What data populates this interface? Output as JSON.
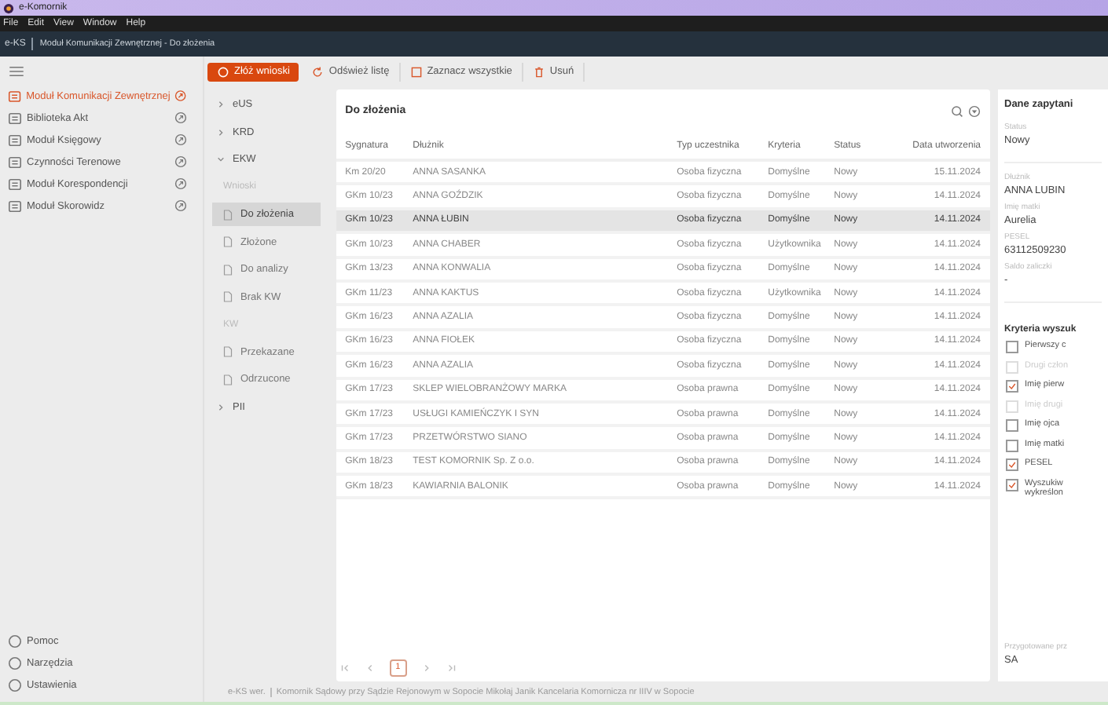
{
  "window": {
    "title": "e-Komornik"
  },
  "menu": [
    "File",
    "Edit",
    "View",
    "Window",
    "Help"
  ],
  "header": {
    "app": "e-KS",
    "breadcrumb": "Moduł Komunikacji Zewnętrznej - Do złożenia"
  },
  "sidebar": {
    "items": [
      {
        "label": "Moduł Komunikacji Zewnętrznej",
        "selected": true
      },
      {
        "label": "Biblioteka Akt",
        "selected": false
      },
      {
        "label": "Moduł Księgowy",
        "selected": false
      },
      {
        "label": "Czynności Terenowe",
        "selected": false
      },
      {
        "label": "Moduł Korespondencji",
        "selected": false
      },
      {
        "label": "Moduł Skorowidz",
        "selected": false
      }
    ],
    "footer": [
      "Pomoc",
      "Narzędzia",
      "Ustawienia"
    ]
  },
  "toolbar": [
    {
      "label": "Złóż wnioski",
      "kind": "primary"
    },
    {
      "label": "Odśwież listę",
      "kind": "refresh"
    },
    {
      "label": "Zaznacz wszystkie",
      "kind": "select"
    },
    {
      "label": "Usuń",
      "kind": "delete"
    }
  ],
  "tree": [
    {
      "label": "eUS",
      "expanded": false
    },
    {
      "label": "KRD",
      "expanded": false
    },
    {
      "label": "EKW",
      "expanded": true,
      "children": [
        {
          "kind": "heading",
          "label": "Wnioski"
        },
        {
          "kind": "item",
          "label": "Do złożenia",
          "selected": true
        },
        {
          "kind": "item",
          "label": "Złożone",
          "selected": false
        },
        {
          "kind": "item",
          "label": "Do analizy",
          "selected": false
        },
        {
          "kind": "item",
          "label": "Brak KW",
          "selected": false
        },
        {
          "kind": "heading",
          "label": "KW"
        },
        {
          "kind": "item",
          "label": "Przekazane",
          "selected": false
        },
        {
          "kind": "item",
          "label": "Odrzucone",
          "selected": false
        }
      ]
    },
    {
      "label": "PII",
      "expanded": false
    }
  ],
  "table": {
    "title": "Do złożenia",
    "columns": [
      "Sygnatura",
      "Dłużnik",
      "Typ uczestnika",
      "Kryteria",
      "Status",
      "Data utworzenia"
    ],
    "rows": [
      {
        "cells": [
          "Km 20/20",
          "ANNA SASANKA",
          "Osoba fizyczna",
          "Domyślne",
          "Nowy",
          "15.11.2024"
        ],
        "selected": false
      },
      {
        "cells": [
          "GKm 10/23",
          "ANNA GOŹDZIK",
          "Osoba fizyczna",
          "Domyślne",
          "Nowy",
          "14.11.2024"
        ],
        "selected": false
      },
      {
        "cells": [
          "GKm 10/23",
          "ANNA ŁUBIN",
          "Osoba fizyczna",
          "Domyślne",
          "Nowy",
          "14.11.2024"
        ],
        "selected": true
      },
      {
        "cells": [
          "GKm 10/23",
          "ANNA CHABER",
          "Osoba fizyczna",
          "Użytkownika",
          "Nowy",
          "14.11.2024"
        ],
        "selected": false
      },
      {
        "cells": [
          "GKm 13/23",
          "ANNA KONWALIA",
          "Osoba fizyczna",
          "Domyślne",
          "Nowy",
          "14.11.2024"
        ],
        "selected": false
      },
      {
        "cells": [
          "GKm 11/23",
          "ANNA KAKTUS",
          "Osoba fizyczna",
          "Użytkownika",
          "Nowy",
          "14.11.2024"
        ],
        "selected": false
      },
      {
        "cells": [
          "GKm 16/23",
          "ANNA AZALIA",
          "Osoba fizyczna",
          "Domyślne",
          "Nowy",
          "14.11.2024"
        ],
        "selected": false
      },
      {
        "cells": [
          "GKm 16/23",
          "ANNA FIOŁEK",
          "Osoba fizyczna",
          "Domyślne",
          "Nowy",
          "14.11.2024"
        ],
        "selected": false
      },
      {
        "cells": [
          "GKm 16/23",
          "ANNA AZALIA",
          "Osoba fizyczna",
          "Domyślne",
          "Nowy",
          "14.11.2024"
        ],
        "selected": false
      },
      {
        "cells": [
          "GKm 17/23",
          "SKLEP WIELOBRANŻOWY MARKA",
          "Osoba prawna",
          "Domyślne",
          "Nowy",
          "14.11.2024"
        ],
        "selected": false
      },
      {
        "cells": [
          "GKm 17/23",
          "USŁUGI KAMIEŃCZYK I SYN",
          "Osoba prawna",
          "Domyślne",
          "Nowy",
          "14.11.2024"
        ],
        "selected": false
      },
      {
        "cells": [
          "GKm 17/23",
          "PRZETWÓRSTWO SIANO",
          "Osoba prawna",
          "Domyślne",
          "Nowy",
          "14.11.2024"
        ],
        "selected": false
      },
      {
        "cells": [
          "GKm 18/23",
          "TEST KOMORNIK Sp. Z o.o.",
          "Osoba prawna",
          "Domyślne",
          "Nowy",
          "14.11.2024"
        ],
        "selected": false
      },
      {
        "cells": [
          "GKm 18/23",
          "KAWIARNIA BALONIK",
          "Osoba prawna",
          "Domyślne",
          "Nowy",
          "14.11.2024"
        ],
        "selected": false
      }
    ],
    "page": "1"
  },
  "details": {
    "title": "Dane zapytani",
    "groups": [
      [
        {
          "label": "Status",
          "value": "Nowy"
        }
      ],
      [
        {
          "label": "Dłużnik",
          "value": "ANNA LUBIN"
        },
        {
          "label": "Imię matki",
          "value": "Aurelia"
        },
        {
          "label": "PESEL",
          "value": "63112509230"
        },
        {
          "label": "Saldo zaliczki",
          "value": "-"
        }
      ]
    ],
    "criteria_title": "Kryteria wyszuk",
    "criteria": [
      {
        "label": "Pierwszy c",
        "checked": false,
        "disabled": false
      },
      {
        "label": "Drugi człon",
        "checked": false,
        "disabled": true
      },
      {
        "label": "Imię pierw",
        "checked": true,
        "disabled": false
      },
      {
        "label": "Imię drugi",
        "checked": false,
        "disabled": true
      },
      {
        "label": "Imię ojca",
        "checked": false,
        "disabled": false
      },
      {
        "label": "Imię matki",
        "checked": false,
        "disabled": false
      },
      {
        "label": "PESEL",
        "checked": true,
        "disabled": false
      },
      {
        "label": "Wyszukiw wykreślon",
        "checked": true,
        "disabled": false
      }
    ],
    "prepared_label": "Przygotowane prz",
    "prepared_value": "SA"
  },
  "status_bar": {
    "version_label": "e-KS wer.",
    "text": "Komornik Sądowy przy Sądzie Rejonowym w Sopocie Mikołaj Janik Kancelaria Komornicza nr IIIV w Sopocie"
  }
}
